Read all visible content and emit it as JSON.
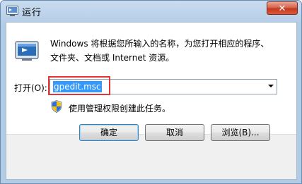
{
  "window": {
    "title": "运行",
    "close_label": "✕"
  },
  "body": {
    "description_line1": "Windows 将根据您所输入的名称，为您打开相应的程序、",
    "description_line2": "文件夹、文档或 Internet 资源。",
    "open_label": "打开(O):",
    "open_value": "gpedit.msc",
    "admin_note": "使用管理权限创建此任务。"
  },
  "buttons": {
    "ok": "确定",
    "cancel": "取消",
    "browse": "浏览(B)..."
  },
  "colors": {
    "selection": "#3399ff",
    "highlight_border": "#e03636"
  },
  "icons": {
    "title": "run-icon",
    "app": "run-program-icon",
    "admin": "uac-shield-icon",
    "dropdown": "chevron-down-icon"
  }
}
